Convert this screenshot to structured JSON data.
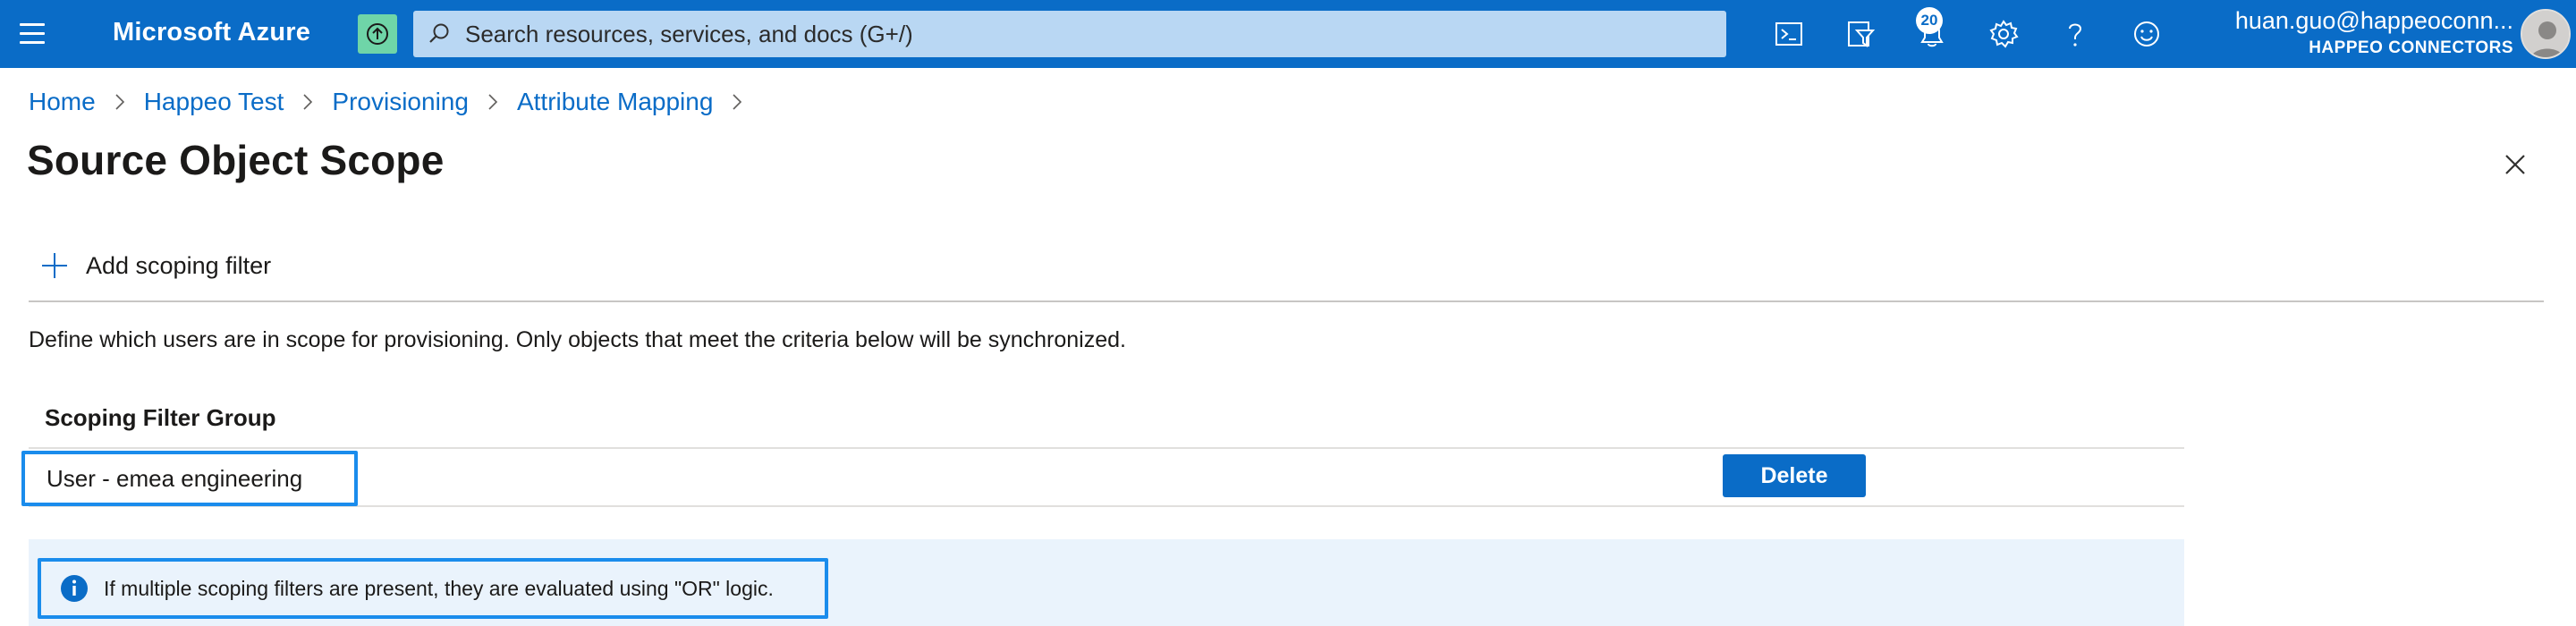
{
  "header": {
    "brand": "Microsoft Azure",
    "search_placeholder": "Search resources, services, and docs (G+/)",
    "notification_count": "20",
    "account_email": "huan.guo@happeoconn...",
    "account_org": "HAPPEO CONNECTORS",
    "icons": [
      "menu-icon",
      "upgrade-icon",
      "search-icon",
      "cloud-shell-icon",
      "directory-filter-icon",
      "bell-icon",
      "gear-icon",
      "help-icon",
      "feedback-icon",
      "avatar"
    ]
  },
  "breadcrumb": {
    "items": [
      "Home",
      "Happeo Test",
      "Provisioning",
      "Attribute Mapping"
    ]
  },
  "page": {
    "title": "Source Object Scope",
    "add_filter_label": "Add scoping filter",
    "description": "Define which users are in scope for provisioning. Only objects that meet the criteria below will be synchronized."
  },
  "table": {
    "column_header": "Scoping Filter Group",
    "rows": [
      {
        "name": "User - emea engineering",
        "action": "Delete"
      }
    ]
  },
  "info": {
    "message": "If multiple scoping filters are present, they are evaluated using \"OR\" logic."
  },
  "colors": {
    "topbar": "#0a6cc7",
    "accent": "#0a6cc7",
    "highlight_border": "#1a8cec",
    "info_background": "#eaf3fc"
  }
}
